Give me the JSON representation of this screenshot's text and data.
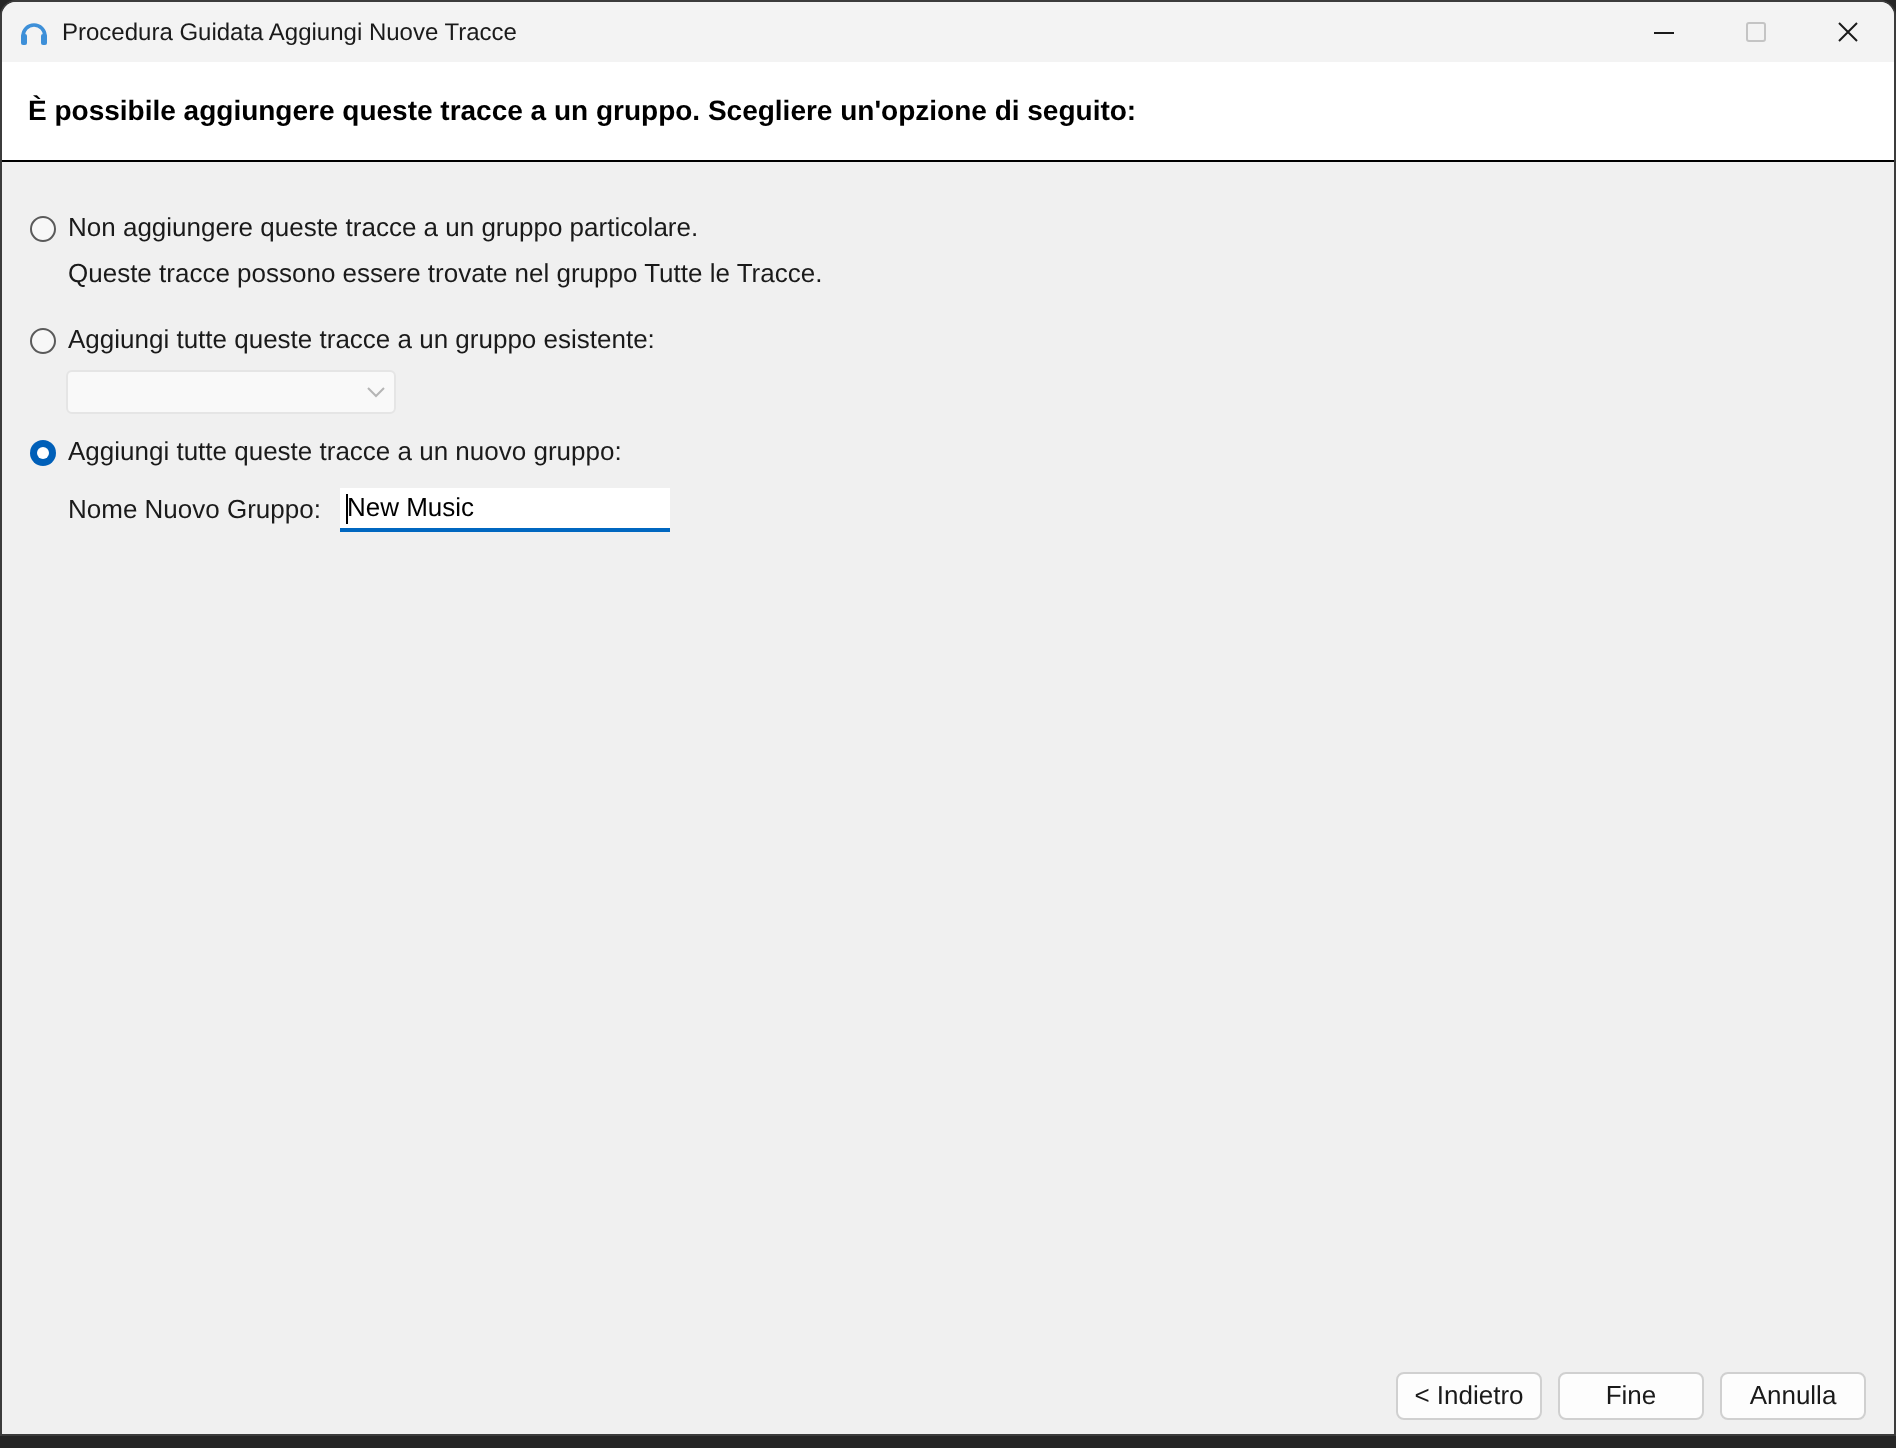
{
  "window": {
    "title": "Procedura Guidata Aggiungi Nuove Tracce",
    "maximize_disabled": true
  },
  "header": {
    "instruction": "È possibile aggiungere queste tracce a un gruppo. Scegliere un'opzione di seguito:"
  },
  "options": [
    {
      "kind": "note",
      "label": "Non aggiungere queste tracce a un gruppo particolare.",
      "selected": false,
      "description": "Queste tracce possono essere trovate nel gruppo Tutte le Tracce."
    },
    {
      "kind": "dropdown",
      "label": "Aggiungi tutte queste tracce a un gruppo esistente:",
      "selected": false,
      "dropdown": {
        "disabled": true
      }
    },
    {
      "kind": "name_field",
      "label": "Aggiungi tutte queste tracce a un nuovo gruppo:",
      "selected": true,
      "field_label": "Nome Nuovo Gruppo:",
      "value": "New Music",
      "focused": true
    }
  ],
  "buttons": [
    {
      "label": "< Indietro"
    },
    {
      "label": "Fine"
    },
    {
      "label": "Annulla"
    }
  ]
}
